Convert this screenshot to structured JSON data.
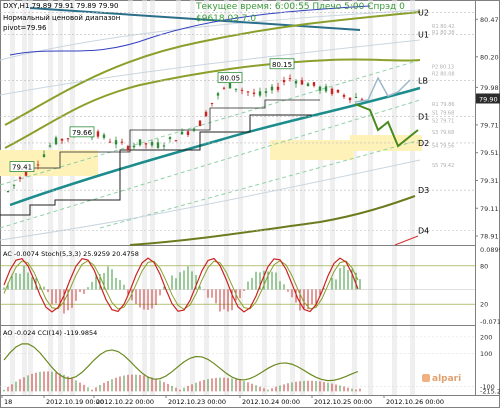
{
  "header": {
    "symbol_line": "DXY,H1  79.89  79.91  79.89  79.90",
    "broker_line1": "Нормальный ценовой диапазон",
    "broker_line2": "pivot=79.96",
    "server_line": "Текущее время: 6:00:55  Плечо 5:00  Спрэд 0",
    "balance_line": "$9618.03   7.0"
  },
  "watermark": "alpari",
  "colors": {
    "background": "#ffffff",
    "candle_up": "#2e8b3a",
    "candle_down": "#cc2222",
    "trend_teal": "#1c8c8c",
    "channel_olive": "#8aa02a",
    "grid_stripe": "#e4e4e4",
    "support_zone": "#fff2b8",
    "price_tag": "#2c2c2c"
  },
  "chart_data": [
    {
      "type": "line",
      "title": "DXY,H1",
      "ylim": [
        78.86,
        80.58
      ],
      "y_ticks": [
        "80.47",
        "80.20",
        "79.98",
        "79.71",
        "79.51",
        "79.31",
        "79.11",
        "78.91"
      ],
      "current_price": "79.90",
      "levels": [
        {
          "name": "U2",
          "value": 80.52
        },
        {
          "name": "U1",
          "value": 80.36
        },
        {
          "name": "LB",
          "value": 80.03
        },
        {
          "name": "D1",
          "value": 79.77
        },
        {
          "name": "D2",
          "value": 79.58
        },
        {
          "name": "D3",
          "value": 79.24
        },
        {
          "name": "D4",
          "value": 78.95
        }
      ],
      "right_labels": [
        "R1 80.42",
        "R1 80.38",
        "P2 80.13",
        "R2 80.08",
        "R1 79.86",
        "S1 79.68",
        "S2 79.71",
        "S3 79.68",
        "S4 79.56",
        "S5 79.42"
      ],
      "annotations": [
        {
          "text": "79.41",
          "value": 79.41
        },
        {
          "text": "79.66",
          "value": 79.66
        },
        {
          "text": "80.05",
          "value": 80.05
        },
        {
          "text": "80.15",
          "value": 80.15
        }
      ],
      "x_ticks": [
        "18",
        "2012.10.19 00:00",
        "2012.10.22 00:00",
        "2012.10.23 00:00",
        "2012.10.24 00:00",
        "2012.10.25 00:00",
        "2012.10.26 00:00"
      ],
      "series": [
        {
          "name": "",
          "values": [
            79.23,
            79.35,
            79.44,
            79.58,
            79.62,
            79.66,
            79.64,
            79.6,
            79.55,
            79.58,
            79.56,
            79.6,
            79.65,
            79.72,
            79.9,
            80.0,
            79.96,
            79.92,
            79.96,
            80.05,
            80.02,
            79.98,
            79.95,
            79.92,
            79.9
          ]
        }
      ]
    },
    {
      "type": "line",
      "title": "AC -0.0074",
      "label2": "Stoch(5,3,3) 25.9259 20.4758",
      "ylim": [
        -0.075,
        0.095
      ],
      "y_ticks": [
        "0.0899",
        "80",
        "20",
        "-0.0713"
      ]
    },
    {
      "type": "bar",
      "title": "AO -0.024",
      "label2": "CCI(14) -119.9854",
      "ylim": [
        -140,
        260
      ],
      "y_ticks": [
        "200",
        "100",
        "-100",
        "-215.21"
      ]
    }
  ]
}
